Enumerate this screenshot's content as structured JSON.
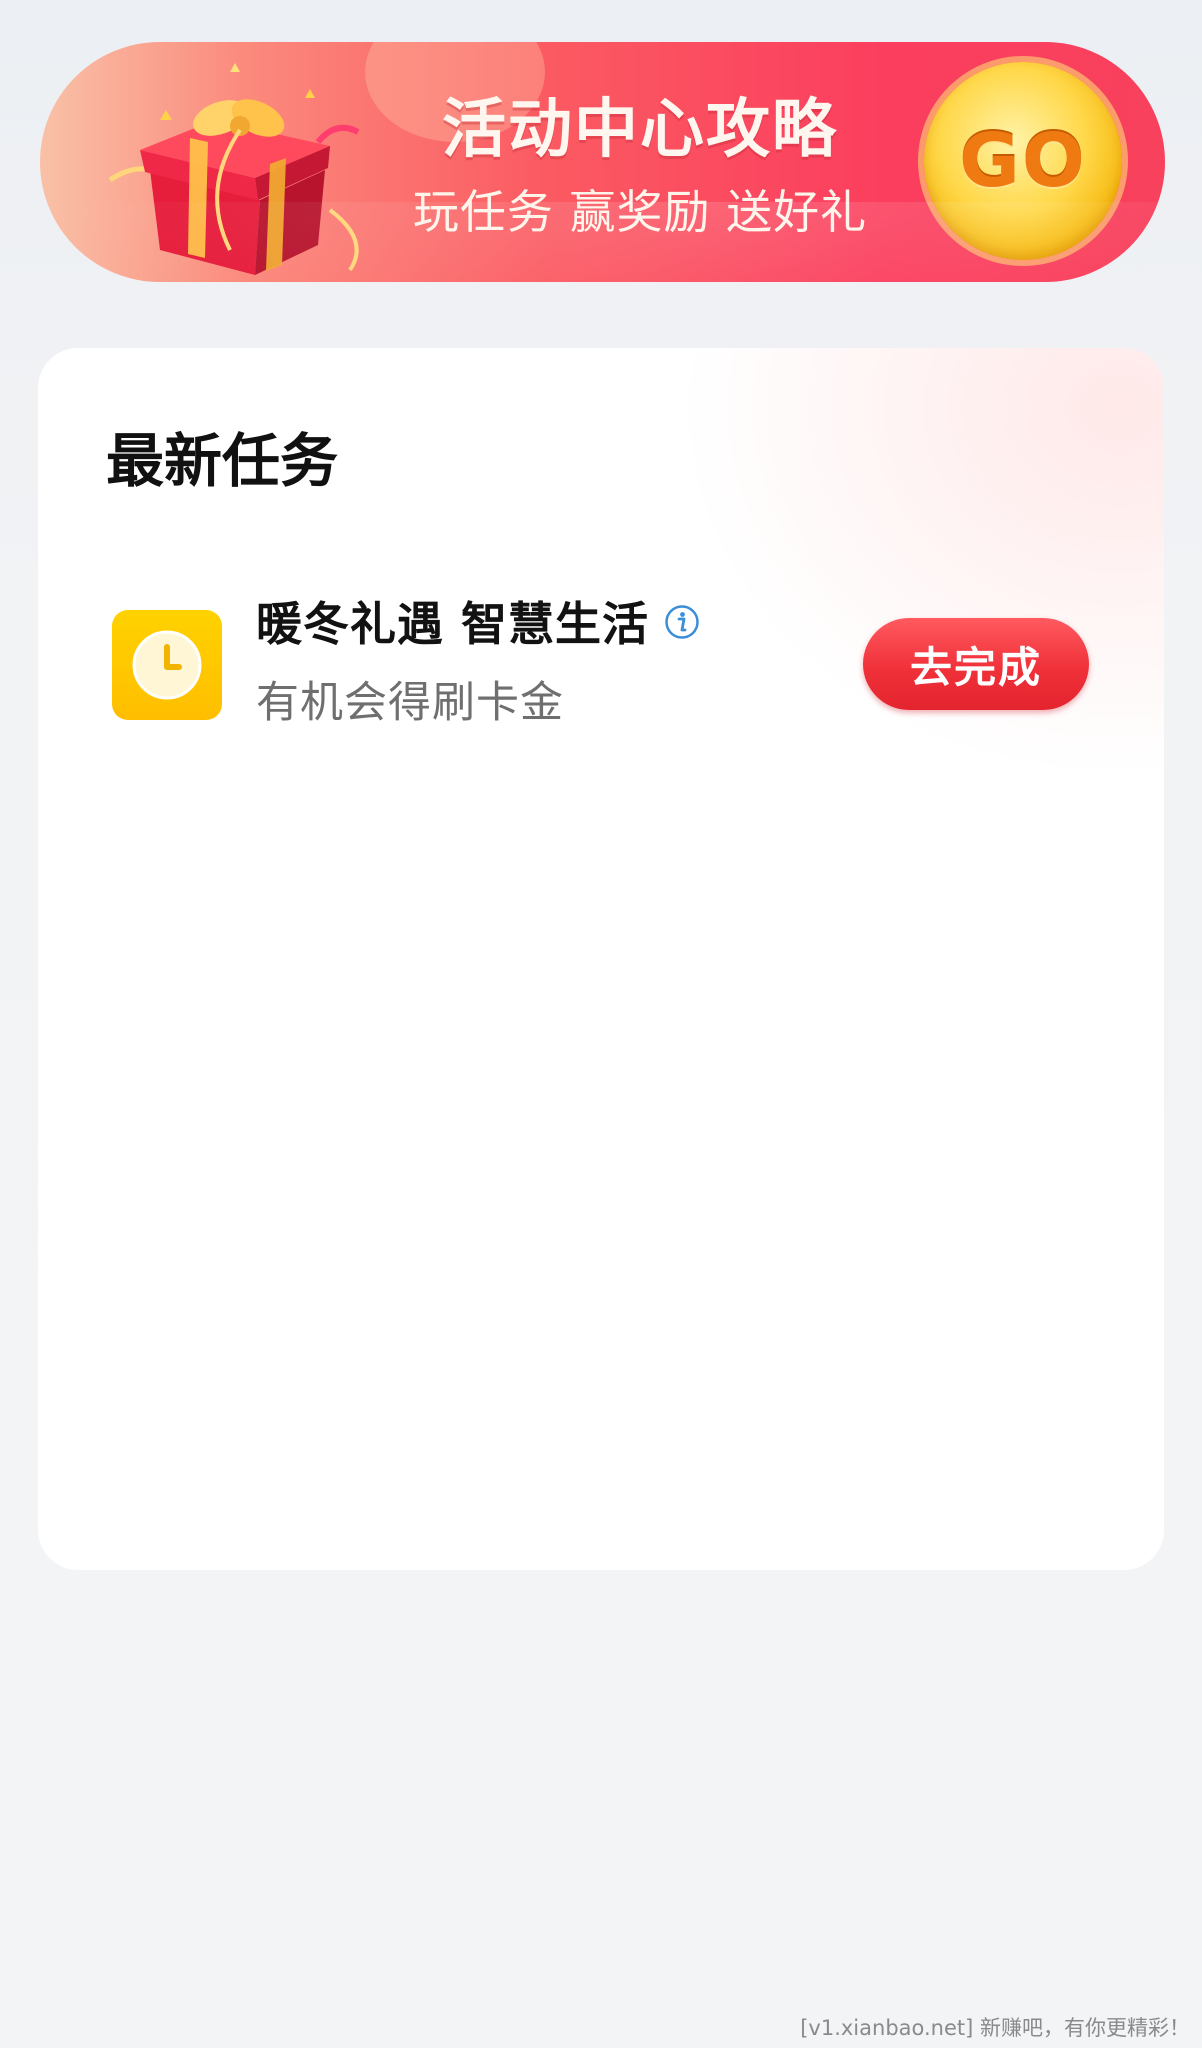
{
  "banner": {
    "title": "活动中心攻略",
    "subtitle": "玩任务 赢奖励 送好礼",
    "go_label": "GO"
  },
  "tasks_section": {
    "title": "最新任务",
    "items": [
      {
        "name": "暖冬礼遇 智慧生活",
        "description": "有机会得刷卡金",
        "action_label": "去完成",
        "icon": "clock-icon",
        "icon_color": "#ffc400"
      }
    ]
  },
  "watermark": "[v1.xianbao.net] 新赚吧，有你更精彩！",
  "colors": {
    "accent_red": "#f0313a",
    "banner_red": "#fb3e5e",
    "gold": "#ffd84a"
  }
}
